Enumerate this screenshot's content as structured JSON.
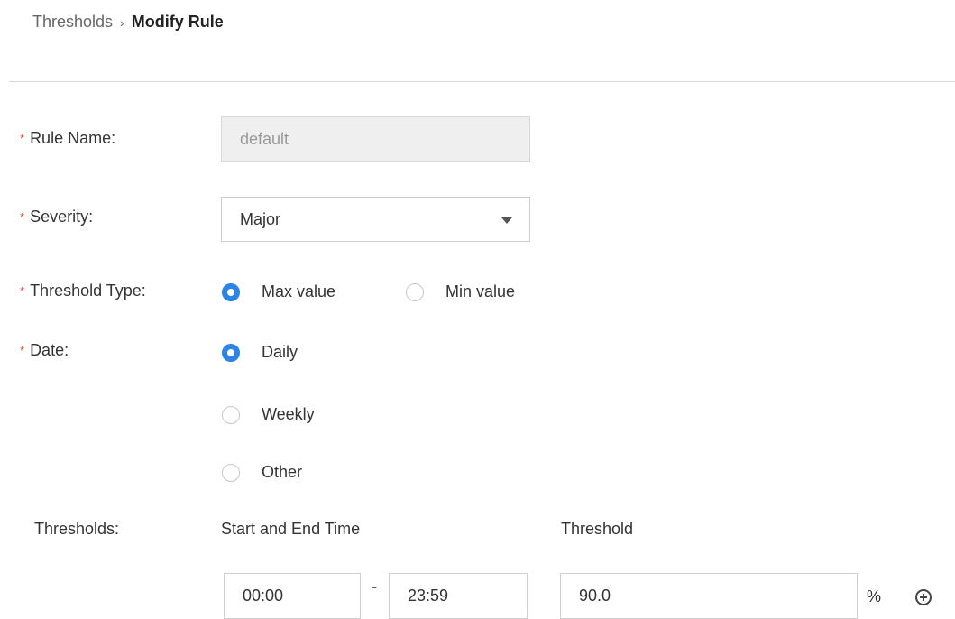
{
  "breadcrumb": {
    "parent": "Thresholds",
    "separator": "›",
    "current": "Modify Rule"
  },
  "form": {
    "required_marker": "*",
    "rule_name": {
      "label": "Rule Name:",
      "value": "default"
    },
    "severity": {
      "label": "Severity:",
      "value": "Major"
    },
    "threshold_type": {
      "label": "Threshold Type:",
      "options": [
        "Max value",
        "Min value"
      ],
      "selected": "Max value"
    },
    "date": {
      "label": "Date:",
      "options": [
        "Daily",
        "Weekly",
        "Other"
      ],
      "selected": "Daily"
    },
    "thresholds": {
      "label": "Thresholds:",
      "time_header": "Start and End Time",
      "threshold_header": "Threshold",
      "start_time": "00:00",
      "time_separator": "-",
      "end_time": "23:59",
      "threshold_value": "90.0",
      "unit": "%"
    }
  },
  "icons": {
    "add": "add-circle-icon"
  },
  "colors": {
    "accent": "#2c85e6",
    "required": "#e84c3d",
    "disabled_bg": "#efefef"
  }
}
